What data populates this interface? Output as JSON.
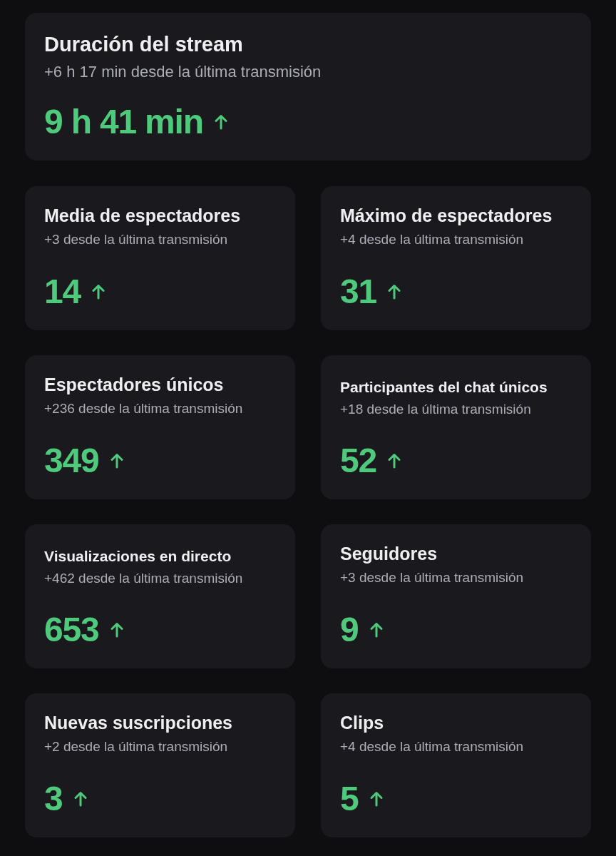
{
  "cards": [
    {
      "title": "Duración del stream",
      "subtitle": "+6 h 17 min desde la última transmisión",
      "value": "9 h 41 min",
      "increase": true
    },
    {
      "title": "Media de espectadores",
      "subtitle": "+3 desde la última transmisión",
      "value": "14",
      "increase": true
    },
    {
      "title": "Máximo de espectadores",
      "subtitle": "+4 desde la última transmisión",
      "value": "31",
      "increase": true
    },
    {
      "title": "Espectadores únicos",
      "subtitle": "+236 desde la última transmisión",
      "value": "349",
      "increase": true
    },
    {
      "title": "Participantes del chat únicos",
      "subtitle": "+18 desde la última transmisión",
      "value": "52",
      "increase": true
    },
    {
      "title": "Visualizaciones en directo",
      "subtitle": "+462 desde la última transmisión",
      "value": "653",
      "increase": true
    },
    {
      "title": "Seguidores",
      "subtitle": "+3 desde la última transmisión",
      "value": "9",
      "increase": true
    },
    {
      "title": "Nuevas suscripciones",
      "subtitle": "+2 desde la última transmisión",
      "value": "3",
      "increase": true
    },
    {
      "title": "Clips",
      "subtitle": "+4 desde la última transmisión",
      "value": "5",
      "increase": true
    }
  ]
}
